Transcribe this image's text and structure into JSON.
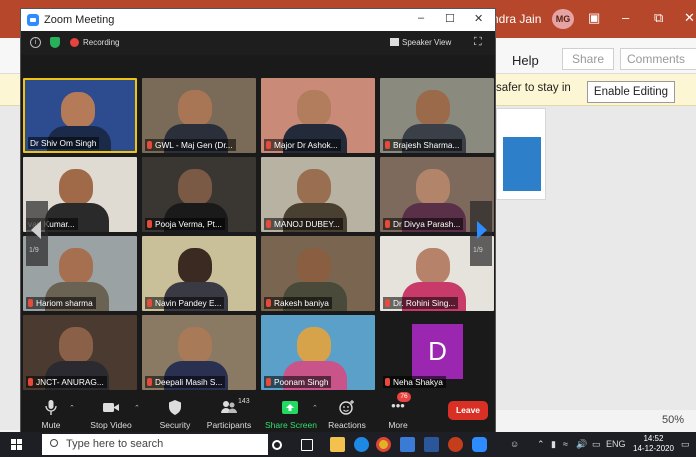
{
  "ppt": {
    "user_name": "ndra Jain",
    "user_initials": "MG",
    "help_label": "Help",
    "share_label": "Share",
    "comments_label": "Comments",
    "protected_msg": "safer to stay in",
    "enable_editing_label": "Enable Editing",
    "zoom_level": "50%"
  },
  "zoom": {
    "window_title": "Zoom Meeting",
    "recording_label": "Recording",
    "view_label": "Speaker View",
    "page_left": "1/9",
    "page_right": "1/9",
    "participants": [
      {
        "name": "Dr Shiv Om Singh",
        "muted": false,
        "active": true,
        "bg": "#2c4c8f",
        "head": "#b57a58",
        "body": "#1c2a4a"
      },
      {
        "name": "GWL - Maj Gen (Dr...",
        "muted": true,
        "active": false,
        "bg": "#7a6a58",
        "head": "#a87654",
        "body": "#2a2f3a"
      },
      {
        "name": "Major Dr Ashok...",
        "muted": true,
        "active": false,
        "bg": "#c98a78",
        "head": "#b17d5c",
        "body": "#232a3a"
      },
      {
        "name": "Brajesh Sharma...",
        "muted": true,
        "active": false,
        "bg": "#8a8a7e",
        "head": "#9a6a4a",
        "body": "#3a3f48"
      },
      {
        "name": "van Kumar...",
        "muted": false,
        "active": false,
        "bg": "#e0dbd2",
        "head": "#a06a48",
        "body": "#2a2a2a"
      },
      {
        "name": "Pooja Verma, Pt...",
        "muted": true,
        "active": false,
        "bg": "#3a3632",
        "head": "#7a5a44",
        "body": "#1a1a1a"
      },
      {
        "name": "MANOJ DUBEY...",
        "muted": true,
        "active": false,
        "bg": "#b7b2a2",
        "head": "#9a6e50",
        "body": "#4a4032"
      },
      {
        "name": "Dr Divya Parash...",
        "muted": true,
        "active": false,
        "bg": "#7d6a5c",
        "head": "#b2846a",
        "body": "#5a3048"
      },
      {
        "name": "Hariom sharma",
        "muted": true,
        "active": false,
        "bg": "#9aa2a4",
        "head": "#a67050",
        "body": "#6a6252"
      },
      {
        "name": "Navin Pandey E...",
        "muted": true,
        "active": false,
        "bg": "#c9c09a",
        "head": "#3a2a22",
        "body": "#3a3a44"
      },
      {
        "name": "Rakesh baniya",
        "muted": true,
        "active": false,
        "bg": "#7a6650",
        "head": "#8a5e40",
        "body": "#4a4a3a"
      },
      {
        "name": "Dr. Rohini Sing...",
        "muted": true,
        "active": false,
        "bg": "#e6e2dc",
        "head": "#b7826a",
        "body": "#c73a6a"
      },
      {
        "name": "JNCT- ANURAG...",
        "muted": true,
        "active": false,
        "bg": "#4a3a30",
        "head": "#8a6048",
        "body": "#2a2a30"
      },
      {
        "name": "Deepali Masih S...",
        "muted": true,
        "active": false,
        "bg": "#8a7a64",
        "head": "#a87a58",
        "body": "#2a3050"
      },
      {
        "name": "Poonam Singh",
        "muted": true,
        "active": false,
        "bg": "#5aa0c8",
        "head": "#d6a24a",
        "body": "#c8548a"
      }
    ],
    "placeholder_tile": {
      "name": "Neha Shakya",
      "initial": "D",
      "muted": true
    },
    "toolbar": {
      "mute": "Mute",
      "stop_video": "Stop Video",
      "security": "Security",
      "participants": "Participants",
      "participants_count": "143",
      "share_screen": "Share Screen",
      "reactions": "Reactions",
      "more": "More",
      "more_badge": "76",
      "leave": "Leave"
    }
  },
  "taskbar": {
    "search_placeholder": "Type here to search",
    "language": "ENG",
    "time": "14:52",
    "date": "14-12-2020"
  }
}
